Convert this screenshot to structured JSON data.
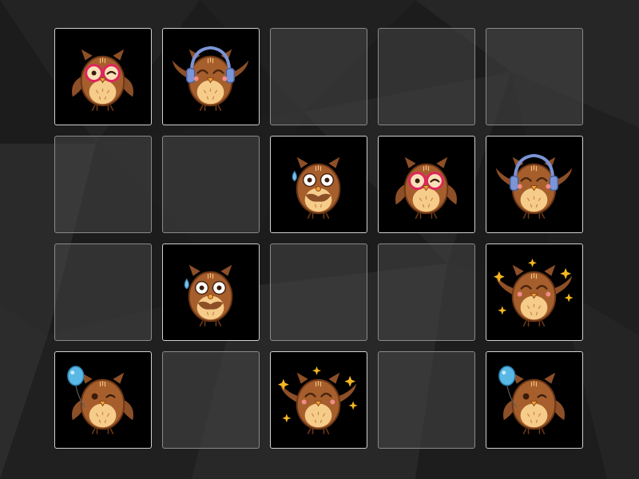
{
  "game": {
    "type": "matching-pairs",
    "rows": 4,
    "columns": 5,
    "card_back_color": "#444444",
    "revealed_card_color": "#000000",
    "cards": [
      {
        "face": "owl-with-glasses",
        "revealed": true
      },
      {
        "face": "owl-with-headphones",
        "revealed": true
      },
      {
        "face": null,
        "revealed": false
      },
      {
        "face": null,
        "revealed": false
      },
      {
        "face": null,
        "revealed": false
      },
      {
        "face": null,
        "revealed": false
      },
      {
        "face": null,
        "revealed": false
      },
      {
        "face": "owl-sweating",
        "revealed": true
      },
      {
        "face": "owl-with-glasses",
        "revealed": true
      },
      {
        "face": "owl-with-headphones",
        "revealed": true
      },
      {
        "face": null,
        "revealed": false
      },
      {
        "face": "owl-sweating",
        "revealed": true
      },
      {
        "face": null,
        "revealed": false
      },
      {
        "face": null,
        "revealed": false
      },
      {
        "face": "owl-celebrating",
        "revealed": true
      },
      {
        "face": "owl-with-balloon",
        "revealed": true
      },
      {
        "face": null,
        "revealed": false
      },
      {
        "face": "owl-celebrating",
        "revealed": true
      },
      {
        "face": null,
        "revealed": false
      },
      {
        "face": "owl-with-balloon",
        "revealed": true
      }
    ]
  }
}
